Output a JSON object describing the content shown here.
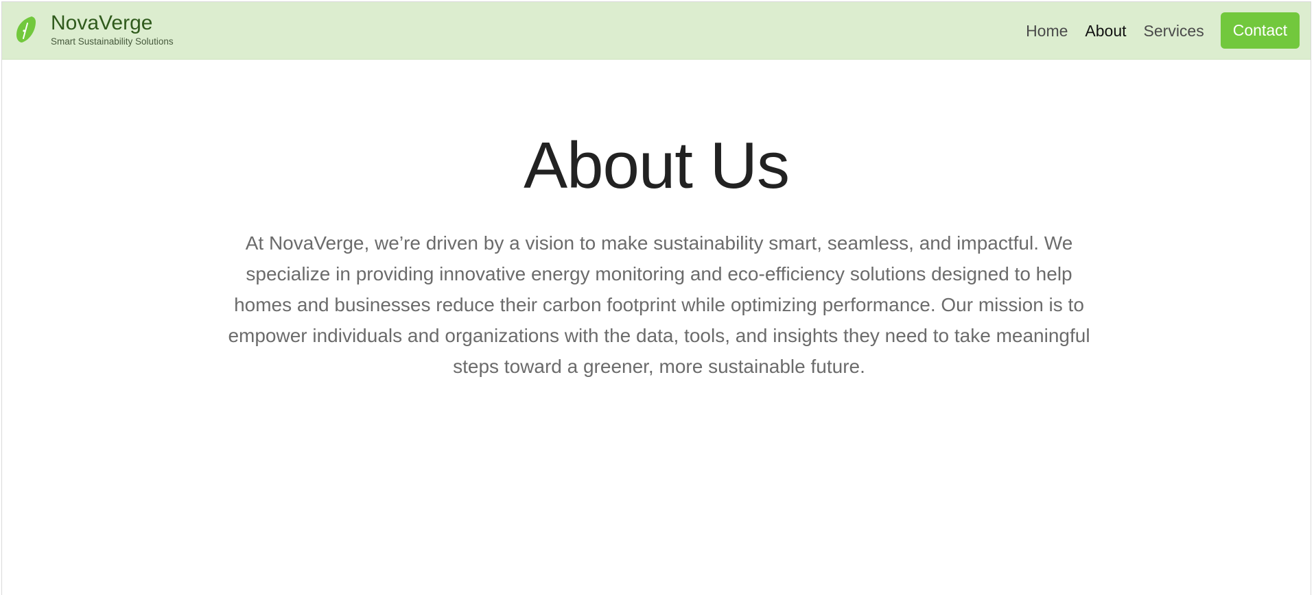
{
  "brand": {
    "name": "NovaVerge",
    "tagline": "Smart Sustainability Solutions",
    "logo_icon": "leaf-icon",
    "accent_color": "#72c83d",
    "header_bg": "#dcedcf"
  },
  "nav": {
    "home": "Home",
    "about": "About",
    "services": "Services",
    "contact": "Contact",
    "active": "About"
  },
  "hero": {
    "title": "About Us",
    "body": "At NovaVerge, we’re driven by a vision to make sustainability smart, seamless, and impactful. We specialize in providing innovative energy monitoring and eco-efficiency solutions designed to help homes and businesses reduce their carbon footprint while optimizing performance. Our mission is to empower individuals and organizations with the data, tools, and insights they need to take meaningful steps toward a greener, more sustainable future."
  }
}
